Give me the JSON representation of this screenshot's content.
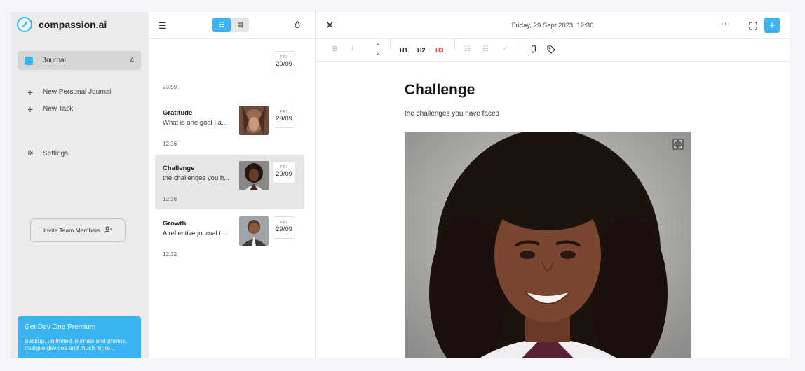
{
  "sidebar": {
    "brand": "compassion.ai",
    "journal": {
      "label": "Journal",
      "count": "4"
    },
    "new_personal_journal": "New Personal Journal",
    "new_task": "New Task",
    "settings": "Settings",
    "invite": "Invite Team Members",
    "premium": {
      "title": "Get Day One Premium",
      "desc": "Backup, unlimited journals and photos, multiple devices and much more..."
    }
  },
  "list": {
    "top_date": {
      "weekday": "FRI",
      "date": "29/09"
    },
    "top_time": "23:59",
    "entries": [
      {
        "title": "Gratitude",
        "preview": "What is one goal I a...",
        "weekday": "FRI",
        "date": "29/09",
        "time": "12:36"
      },
      {
        "title": "Challenge",
        "preview": "the challenges you h...",
        "weekday": "FRI",
        "date": "29/09",
        "time": "12:36"
      },
      {
        "title": "Growth",
        "preview": "A reflective journal t...",
        "weekday": "FRI",
        "date": "29/09",
        "time": "12:32"
      }
    ]
  },
  "editor": {
    "datetime": "Friday, 29 Sept 2023, 12:36",
    "toolbar": {
      "bold": "B",
      "italic": "I",
      "h1": "H1",
      "h2": "H2",
      "h3": "H3"
    },
    "title": "Challenge",
    "subtitle": "the challenges you have faced"
  },
  "colors": {
    "accent": "#3ab3f0",
    "h3_active": "#e0433a"
  }
}
